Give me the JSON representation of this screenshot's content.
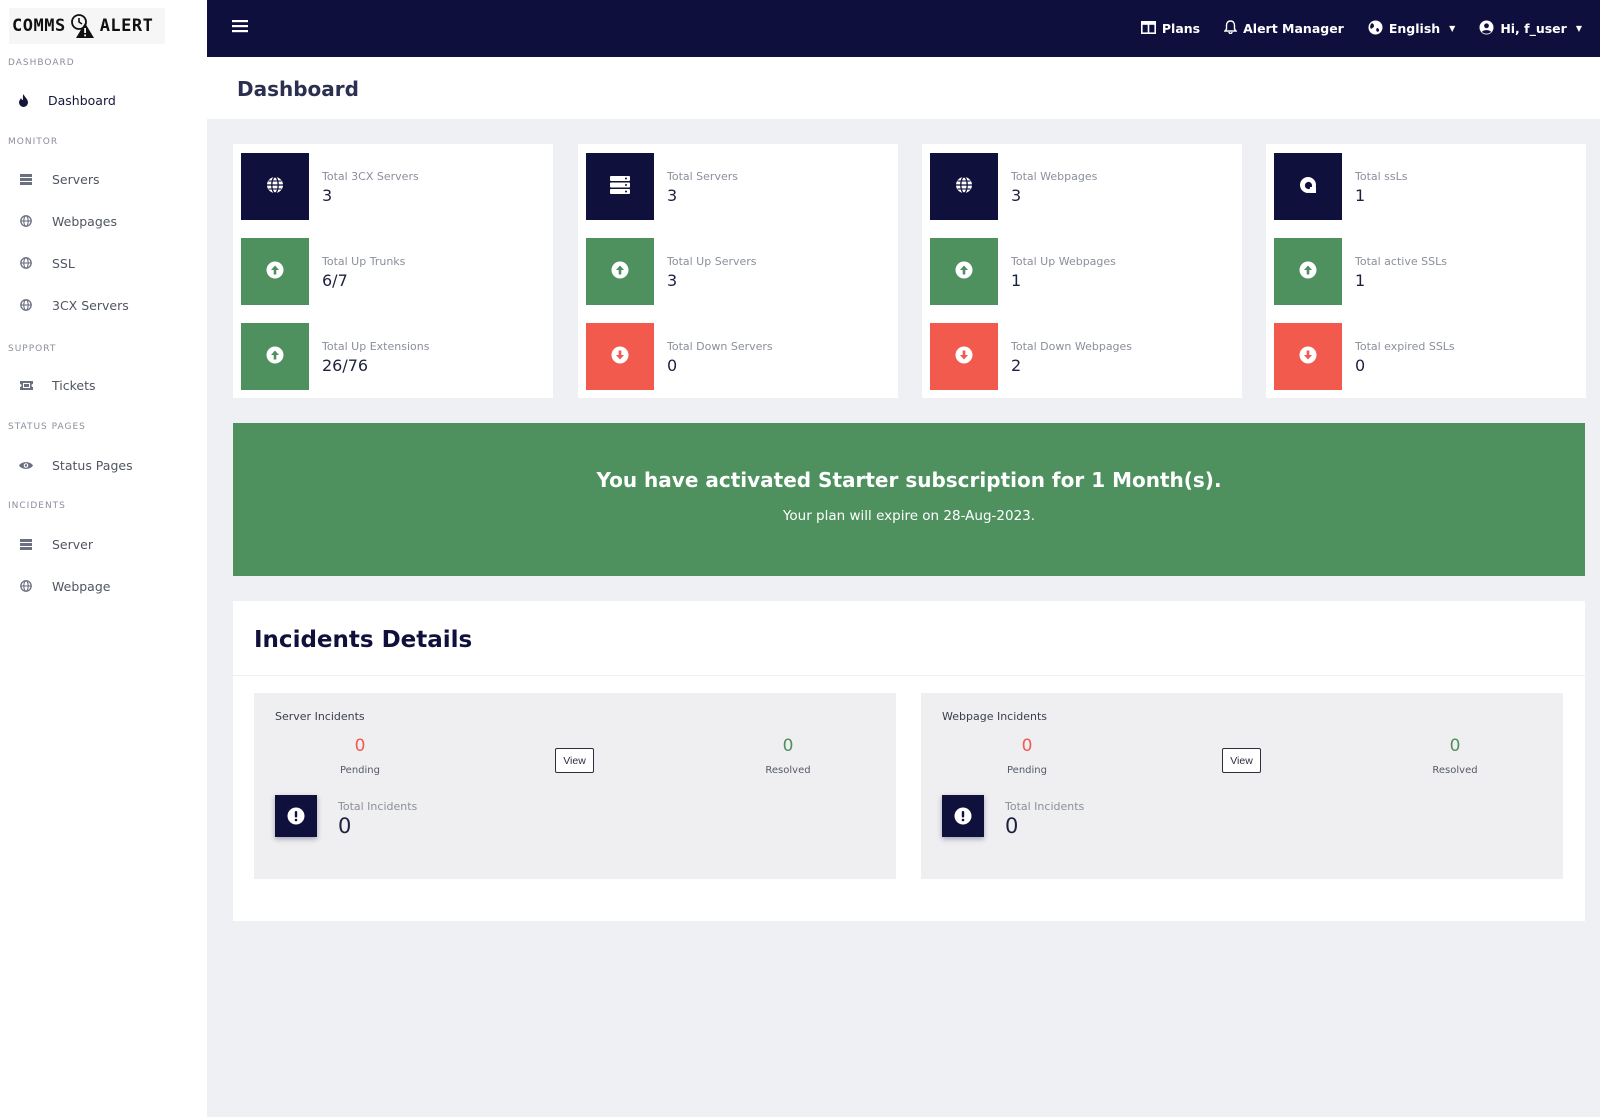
{
  "app": {
    "logo_left": "COMMS",
    "logo_right": "ALERT"
  },
  "topbar": {
    "plans": "Plans",
    "alert_manager": "Alert Manager",
    "language": "English",
    "user": "Hi, f_user"
  },
  "sidebar": {
    "sections": {
      "dashboard": "DASHBOARD",
      "monitor": "MONITOR",
      "support": "SUPPORT",
      "status_pages": "STATUS PAGES",
      "incidents": "INCIDENTS"
    },
    "items": {
      "dashboard": "Dashboard",
      "servers": "Servers",
      "webpages": "Webpages",
      "ssl": "SSL",
      "cx_servers": "3CX Servers",
      "tickets": "Tickets",
      "status_pages": "Status Pages",
      "server": "Server",
      "webpage": "Webpage"
    }
  },
  "page": {
    "title": "Dashboard"
  },
  "cards": [
    {
      "stats": [
        {
          "label": "Total 3CX Servers",
          "value": "3"
        },
        {
          "label": "Total Up Trunks",
          "value": "6/7"
        },
        {
          "label": "Total Up Extensions",
          "value": "26/76"
        }
      ]
    },
    {
      "stats": [
        {
          "label": "Total Servers",
          "value": "3"
        },
        {
          "label": "Total Up Servers",
          "value": "3"
        },
        {
          "label": "Total Down Servers",
          "value": "0"
        }
      ]
    },
    {
      "stats": [
        {
          "label": "Total Webpages",
          "value": "3"
        },
        {
          "label": "Total Up Webpages",
          "value": "1"
        },
        {
          "label": "Total Down Webpages",
          "value": "2"
        }
      ]
    },
    {
      "stats": [
        {
          "label": "Total ssLs",
          "value": "1"
        },
        {
          "label": "Total active SSLs",
          "value": "1"
        },
        {
          "label": "Total expired SSLs",
          "value": "0"
        }
      ]
    }
  ],
  "banner": {
    "title": "You have activated Starter subscription for 1 Month(s).",
    "subtitle": "Your plan will expire on 28-Aug-2023."
  },
  "incidents": {
    "title": "Incidents Details",
    "panels": [
      {
        "title": "Server Incidents",
        "pending": "0",
        "pending_label": "Pending",
        "view": "View",
        "resolved": "0",
        "resolved_label": "Resolved",
        "total_label": "Total Incidents",
        "total": "0"
      },
      {
        "title": "Webpage Incidents",
        "pending": "0",
        "pending_label": "Pending",
        "view": "View",
        "resolved": "0",
        "resolved_label": "Resolved",
        "total_label": "Total Incidents",
        "total": "0"
      }
    ]
  },
  "colors": {
    "navy": "#10103c",
    "green": "#4e915f",
    "red": "#f25a4e",
    "background": "#eef0f4"
  }
}
